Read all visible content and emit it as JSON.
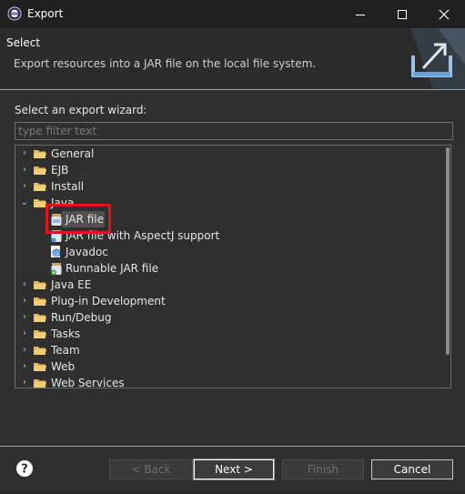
{
  "window": {
    "title": "Export",
    "buttons": [
      "minimize",
      "maximize",
      "close"
    ]
  },
  "header": {
    "title": "Select",
    "description": "Export resources into a JAR file on the local file system."
  },
  "wizard": {
    "label": "Select an export wizard:",
    "filter_placeholder": "type filter text",
    "filter_value": ""
  },
  "tree": {
    "items": [
      {
        "label": "General",
        "icon": "folder-icon",
        "expanded": false
      },
      {
        "label": "EJB",
        "icon": "folder-icon",
        "expanded": false
      },
      {
        "label": "Install",
        "icon": "folder-icon",
        "expanded": false
      },
      {
        "label": "Java",
        "icon": "folder-icon",
        "expanded": true
      },
      {
        "label": "JAR file",
        "icon": "jar-icon",
        "selected": true
      },
      {
        "label": "JAR file with AspectJ support",
        "icon": "aspectj-jar-icon"
      },
      {
        "label": "Javadoc",
        "icon": "javadoc-icon"
      },
      {
        "label": "Runnable JAR file",
        "icon": "runnable-jar-icon"
      },
      {
        "label": "Java EE",
        "icon": "folder-icon",
        "expanded": false
      },
      {
        "label": "Plug-in Development",
        "icon": "folder-icon",
        "expanded": false
      },
      {
        "label": "Run/Debug",
        "icon": "folder-icon",
        "expanded": false
      },
      {
        "label": "Tasks",
        "icon": "folder-icon",
        "expanded": false
      },
      {
        "label": "Team",
        "icon": "folder-icon",
        "expanded": false
      },
      {
        "label": "Web",
        "icon": "folder-icon",
        "expanded": false
      },
      {
        "label": "Web Services",
        "icon": "folder-icon",
        "expanded": false
      }
    ]
  },
  "footer": {
    "help_icon": "help-icon",
    "back_label": "< Back",
    "next_label": "Next >",
    "finish_label": "Finish",
    "cancel_label": "Cancel"
  },
  "colors": {
    "background": "#2f2f2f",
    "titlebar": "#202020",
    "highlight_box": "#e0141e",
    "selection": "#505050"
  }
}
